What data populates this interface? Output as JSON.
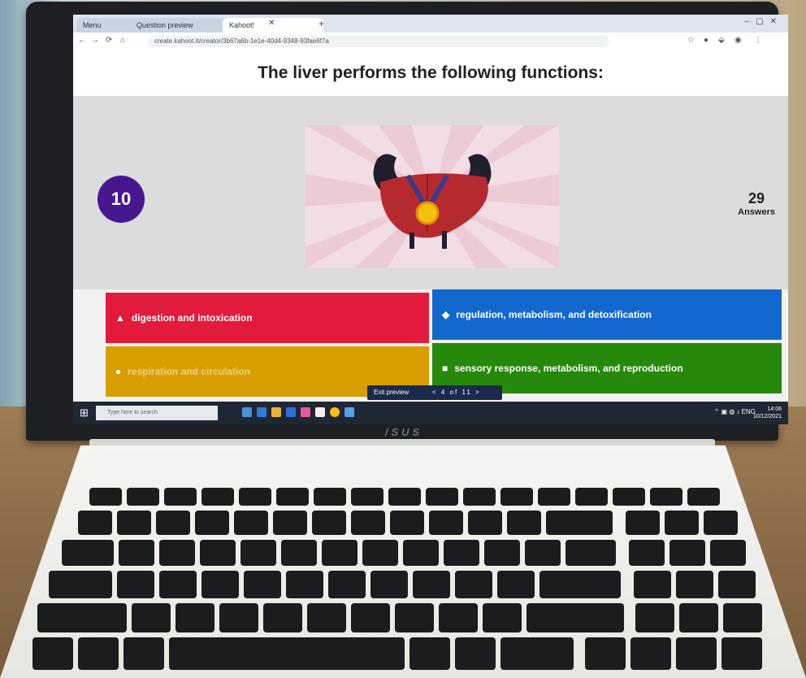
{
  "browser": {
    "tabs": [
      {
        "label": "Menu"
      },
      {
        "label": "Question preview"
      },
      {
        "label": "Kahoot!"
      }
    ],
    "url": "create.kahoot.it/creator/3b67a6b-1e1e-40d4-9348-93fae6f7a"
  },
  "quiz": {
    "question": "The liver performs the following functions:",
    "timer": "10",
    "answers_count": "29",
    "answers_label": "Answers",
    "image_icon": "flexing-liver-with-medal",
    "options": [
      {
        "shape": "▲",
        "text": "digestion and intoxication",
        "color": "#e21b3c"
      },
      {
        "shape": "◆",
        "text": "regulation, metabolism, and detoxification",
        "color": "#1368ce"
      },
      {
        "shape": "●",
        "text": "respiration and circulation",
        "color": "#d89e00"
      },
      {
        "shape": "■",
        "text": "sensory response, metabolism, and reproduction",
        "color": "#26890c"
      }
    ],
    "preview_label": "Exit preview",
    "preview_nav": "<  4 of 11  >"
  },
  "taskbar": {
    "search_placeholder": "Type here to search",
    "clock_time": "14:06",
    "clock_date": "10/12/2021"
  },
  "device": {
    "brand": "/SUS"
  }
}
